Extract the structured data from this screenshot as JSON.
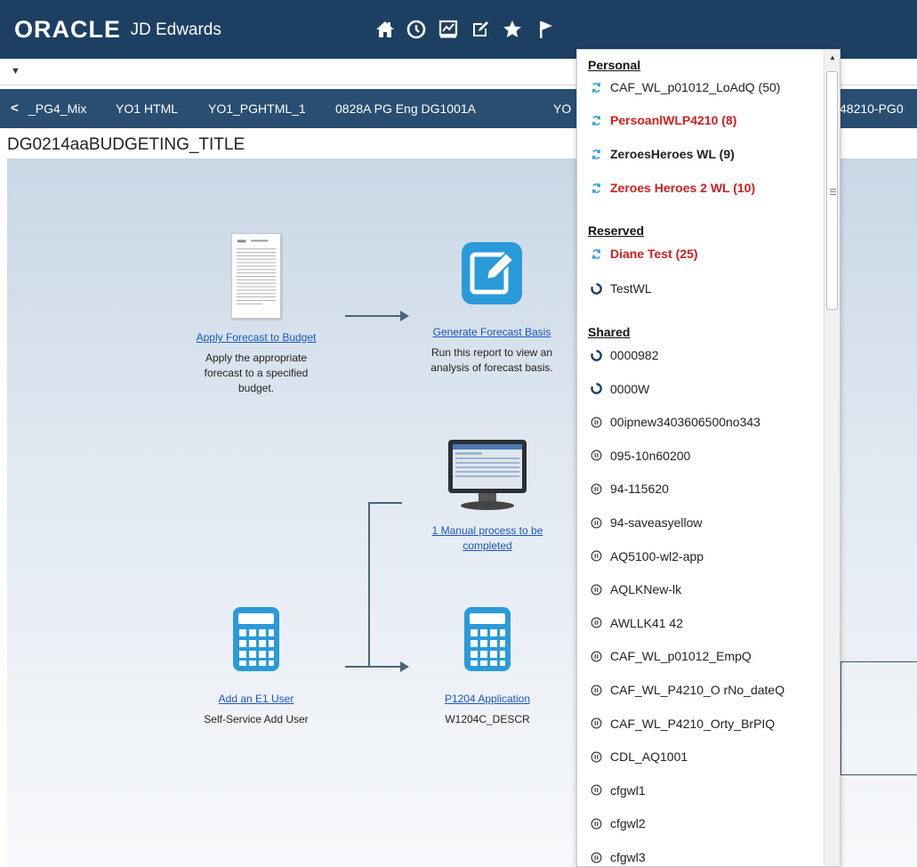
{
  "header": {
    "logo_brand": "ORACLE",
    "logo_product": "JD Edwards",
    "icons": [
      "home-icon",
      "recent-icon",
      "watchlist-icon",
      "edit-icon",
      "favorites-icon",
      "flag-icon"
    ]
  },
  "tabs": {
    "items": [
      "_PG4_Mix",
      "YO1 HTML",
      "YO1_PGHTML_1",
      "0828A PG Eng DG1001A",
      "YO",
      "48210-PG0"
    ]
  },
  "page": {
    "title": "DG0214aaBUDGETING_TITLE"
  },
  "tasks": {
    "apply_forecast": {
      "link": "Apply Forecast to Budget",
      "desc1": "Apply the appropriate",
      "desc2": "forecast to a specified",
      "desc3": "budget."
    },
    "generate_forecast": {
      "link": "Generate Forecast Basis",
      "desc1": "Run this report to view an",
      "desc2": "analysis of forecast basis."
    },
    "manual_process": {
      "link1": "1 Manual process to be",
      "link2": "completed"
    },
    "add_user": {
      "link": "Add an E1 User",
      "desc": "Self-Service Add User"
    },
    "p1204": {
      "link": "P1204 Application",
      "desc": "W1204C_DESCR"
    }
  },
  "watchlist_menu": {
    "personal_label": "Personal",
    "personal": [
      {
        "label": "CAF_WL_p01012_LoAdQ (50)",
        "style": "normal"
      },
      {
        "label": "PersoanlWLP4210 (8)",
        "style": "red"
      },
      {
        "label": "ZeroesHeroes WL (9)",
        "style": "bold"
      },
      {
        "label": "Zeroes Heroes 2 WL (10)",
        "style": "red"
      }
    ],
    "reserved_label": "Reserved",
    "reserved": [
      {
        "label": "Diane Test (25)",
        "style": "red",
        "icon": "refresh-icon"
      },
      {
        "label": "TestWL",
        "style": "normal",
        "icon": "circle-icon"
      }
    ],
    "shared_label": "Shared",
    "shared": [
      {
        "label": "0000982",
        "icon": "circle-icon"
      },
      {
        "label": "0000W",
        "icon": "circle-icon"
      },
      {
        "label": "00ipnew3403606500no343",
        "icon": "pause-icon"
      },
      {
        "label": "095-10n60200",
        "icon": "pause-icon"
      },
      {
        "label": "94-115620",
        "icon": "pause-icon"
      },
      {
        "label": "94-saveasyellow",
        "icon": "pause-icon"
      },
      {
        "label": "AQ5100-wl2-app",
        "icon": "pause-icon"
      },
      {
        "label": "AQLKNew-lk",
        "icon": "pause-icon"
      },
      {
        "label": "AWLLK41 42",
        "icon": "pause-icon"
      },
      {
        "label": "CAF_WL_p01012_EmpQ",
        "icon": "pause-icon"
      },
      {
        "label": "CAF_WL_P4210_O rNo_dateQ",
        "icon": "pause-icon"
      },
      {
        "label": "CAF_WL_P4210_Orty_BrPIQ",
        "icon": "pause-icon"
      },
      {
        "label": "CDL_AQ1001",
        "icon": "pause-icon"
      },
      {
        "label": "cfgwl1",
        "icon": "pause-icon"
      },
      {
        "label": "cfgwl2",
        "icon": "pause-icon"
      },
      {
        "label": "cfgwl3",
        "icon": "pause-icon"
      }
    ]
  },
  "colors": {
    "header_bg": "#1d3f62",
    "tab_bg": "#2a4e72",
    "link": "#1a56c4",
    "alert_red": "#d01e1e",
    "icon_blue": "#2b9ad9"
  }
}
